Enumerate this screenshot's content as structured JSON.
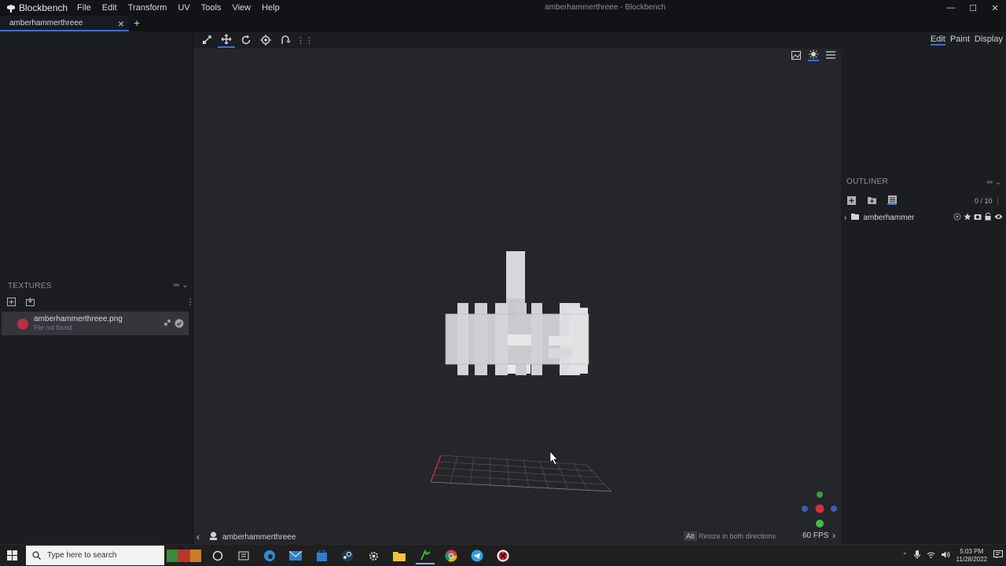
{
  "window": {
    "app_name": "Blockbench",
    "title": "amberhammerthreee - Blockbench",
    "menu": [
      "File",
      "Edit",
      "Transform",
      "UV",
      "Tools",
      "View",
      "Help"
    ]
  },
  "tabs": [
    {
      "label": "amberhammerthreee"
    }
  ],
  "textures_panel": {
    "title": "TEXTURES",
    "items": [
      {
        "name": "amberhammerthreee.png",
        "status": "File not found"
      }
    ]
  },
  "viewport": {
    "tools": [
      "move-all-icon",
      "move-icon",
      "rotate-icon",
      "pivot-icon",
      "vertex-snap-icon"
    ],
    "status": {
      "model_name": "amberhammerthreee",
      "key_hint": "Alt",
      "hint_text": "Resize in both directions",
      "fps": "60 FPS"
    }
  },
  "mode_tabs": [
    "Edit",
    "Paint",
    "Display"
  ],
  "outliner": {
    "title": "OUTLINER",
    "count": "0 / 10",
    "items": [
      {
        "name": "amberhammer"
      }
    ]
  },
  "taskbar": {
    "search_placeholder": "Type here to search",
    "time": "5:03 PM",
    "date": "11/28/2022"
  },
  "colors": {
    "accent": "#3b6fd8",
    "background": "#25262a",
    "panel": "#1c1d21"
  }
}
